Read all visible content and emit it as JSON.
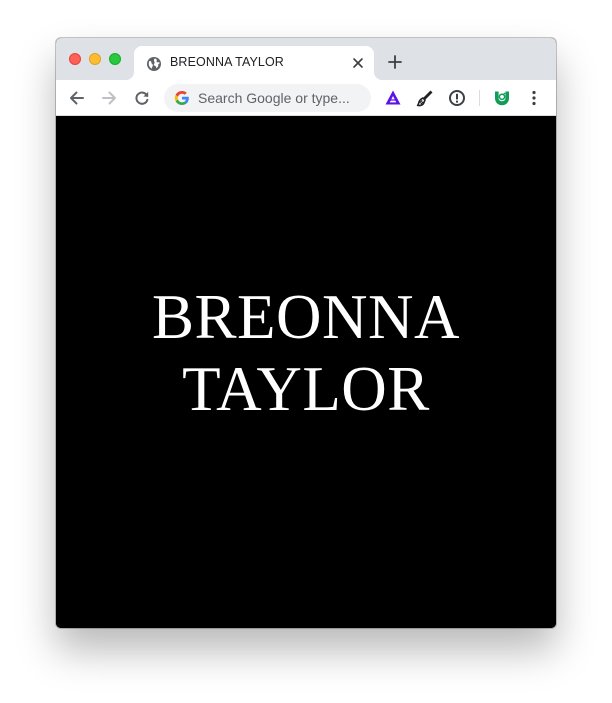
{
  "window": {
    "controls": [
      "close",
      "minimize",
      "maximize"
    ]
  },
  "tab": {
    "title": "BREONNA TAYLOR",
    "favicon": "globe-icon"
  },
  "toolbar": {
    "omnibox_placeholder": "Search Google or type...",
    "extensions": [
      "triangle-extension-icon",
      "brush-extension-icon",
      "info-extension-icon",
      "green-shield-extension-icon"
    ]
  },
  "page": {
    "heading_line_1": "BREONNA",
    "heading_line_2": "TAYLOR",
    "background_color": "#000000",
    "text_color": "#ffffff"
  },
  "colors": {
    "tabstrip": "#dee1e6",
    "traffic_close": "#fe5f57",
    "traffic_minimize": "#febc2e",
    "traffic_maximize": "#28c840",
    "extension_purple": "#5b13e8",
    "extension_green": "#0f9d58"
  }
}
